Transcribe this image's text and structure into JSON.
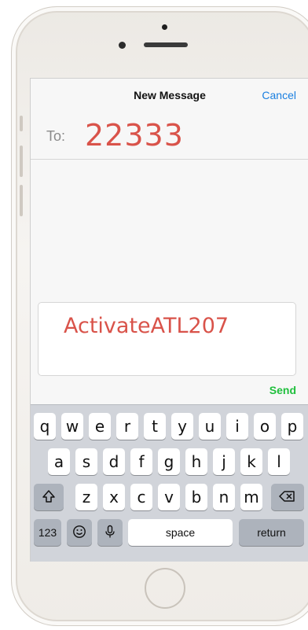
{
  "nav": {
    "title": "New Message",
    "cancel_label": "Cancel"
  },
  "recipient": {
    "label": "To:",
    "value": "22333"
  },
  "compose": {
    "text": "ActivateATL207",
    "send_label": "Send"
  },
  "keyboard": {
    "row1": [
      "q",
      "w",
      "e",
      "r",
      "t",
      "y",
      "u",
      "i",
      "o",
      "p"
    ],
    "row2": [
      "a",
      "s",
      "d",
      "f",
      "g",
      "h",
      "j",
      "k",
      "l"
    ],
    "row3": [
      "z",
      "x",
      "c",
      "v",
      "b",
      "n",
      "m"
    ],
    "numbers_label": "123",
    "space_label": "space",
    "return_label": "return",
    "icons": [
      "shift-icon",
      "backspace-icon",
      "emoji-icon",
      "microphone-icon"
    ]
  },
  "colors": {
    "accent_blue": "#1a7fe0",
    "send_green": "#1fbf3c",
    "typed_red": "#d9534a"
  }
}
